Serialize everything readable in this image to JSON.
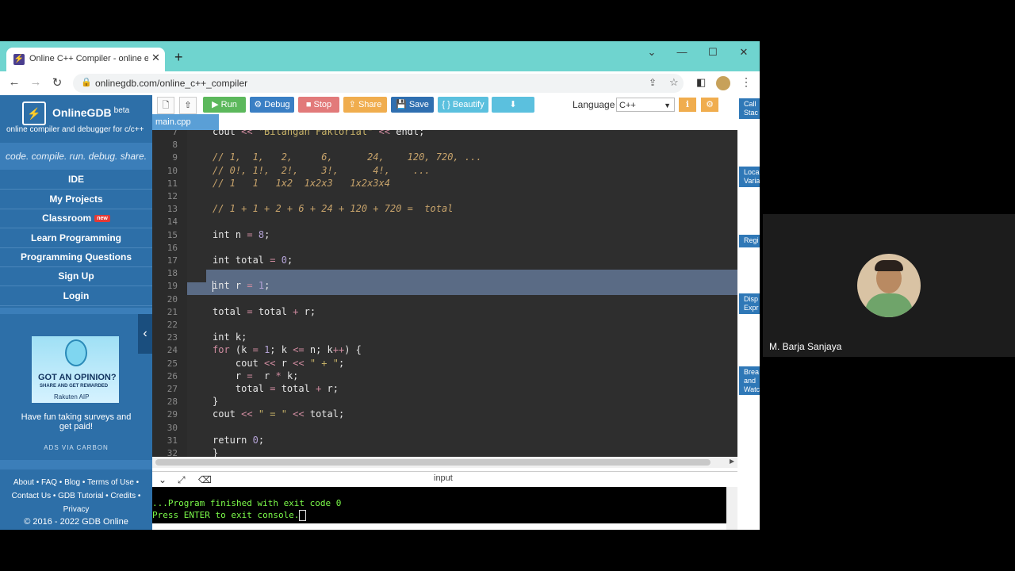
{
  "browser": {
    "tab_title": "Online C++ Compiler - online ed",
    "tab_favicon": "onlinegdb-icon",
    "url": "onlinegdb.com/online_c++_compiler",
    "window_controls": [
      "minimize",
      "maximize",
      "close"
    ]
  },
  "sidebar": {
    "brand": "OnlineGDB",
    "beta": "beta",
    "subtitle": "online compiler and debugger for c/c++",
    "tagline": "code. compile. run. debug. share.",
    "nav": [
      {
        "label": "IDE"
      },
      {
        "label": "My Projects"
      },
      {
        "label": "Classroom",
        "badge": "new"
      },
      {
        "label": "Learn Programming"
      },
      {
        "label": "Programming Questions"
      },
      {
        "label": "Sign Up"
      },
      {
        "label": "Login"
      }
    ],
    "ad": {
      "headline": "GOT AN OPINION?",
      "sub": "SHARE AND GET REWARDED",
      "brand": "Rakuten AIP",
      "text": "Have fun taking surveys and get paid!",
      "via": "ADS VIA CARBON"
    },
    "footer": {
      "line1": "About • FAQ • Blog • Terms of Use •",
      "line2": "Contact Us • GDB Tutorial • Credits •",
      "line3": "Privacy",
      "copyright": "© 2016 - 2022 GDB Online"
    }
  },
  "toolbar": {
    "run": "Run",
    "debug": "Debug",
    "stop": "Stop",
    "share": "Share",
    "save": "Save",
    "beautify": "{ } Beautify",
    "language_label": "Language",
    "language_value": "C++",
    "colors": {
      "run": "#5cb85c",
      "debug": "#3a7fc4",
      "stop": "#e27a7a",
      "share": "#f0ad4e",
      "save": "#2f6fb0",
      "beautify": "#5bc0de",
      "download": "#5bc0de"
    }
  },
  "file_tab": "main.cpp",
  "editor": {
    "lines": [
      {
        "n": "7",
        "code": "cout << \"Bilangan Faktorial\" << endl;"
      },
      {
        "n": "8",
        "code": ""
      },
      {
        "n": "9",
        "code": "// 1,  1,   2,     6,      24,    120, 720, ..."
      },
      {
        "n": "10",
        "code": "// 0!, 1!,  2!,    3!,      4!,    ..."
      },
      {
        "n": "11",
        "code": "// 1   1   1x2  1x2x3   1x2x3x4"
      },
      {
        "n": "12",
        "code": ""
      },
      {
        "n": "13",
        "code": "// 1 + 1 + 2 + 6 + 24 + 120 + 720 =  total"
      },
      {
        "n": "14",
        "code": ""
      },
      {
        "n": "15",
        "code": "int n = 8;"
      },
      {
        "n": "16",
        "code": ""
      },
      {
        "n": "17",
        "code": "int total = 0;"
      },
      {
        "n": "18",
        "code": ""
      },
      {
        "n": "19",
        "code": "int r = 1;"
      },
      {
        "n": "20",
        "code": ""
      },
      {
        "n": "21",
        "code": "total = total + r;"
      },
      {
        "n": "22",
        "code": ""
      },
      {
        "n": "23",
        "code": "int k;"
      },
      {
        "n": "24",
        "code": "for (k = 1; k <= n; k++) {"
      },
      {
        "n": "25",
        "code": "    cout << r << \" + \";"
      },
      {
        "n": "26",
        "code": "    r =  r * k;"
      },
      {
        "n": "27",
        "code": "    total = total + r;"
      },
      {
        "n": "28",
        "code": "}"
      },
      {
        "n": "29",
        "code": "cout << \" = \" << total;"
      },
      {
        "n": "30",
        "code": ""
      },
      {
        "n": "31",
        "code": "return 0;"
      },
      {
        "n": "32",
        "code": "}"
      }
    ]
  },
  "right_panel": [
    "Call\nStac",
    "Loca\nVaria",
    "Regi",
    "Disp\nExpr",
    "Brea\nand\nWatc"
  ],
  "io": {
    "label": "input",
    "console": [
      "...Program finished with exit code 0",
      "Press ENTER to exit console."
    ]
  },
  "participant": {
    "name": "M. Barja Sanjaya"
  }
}
